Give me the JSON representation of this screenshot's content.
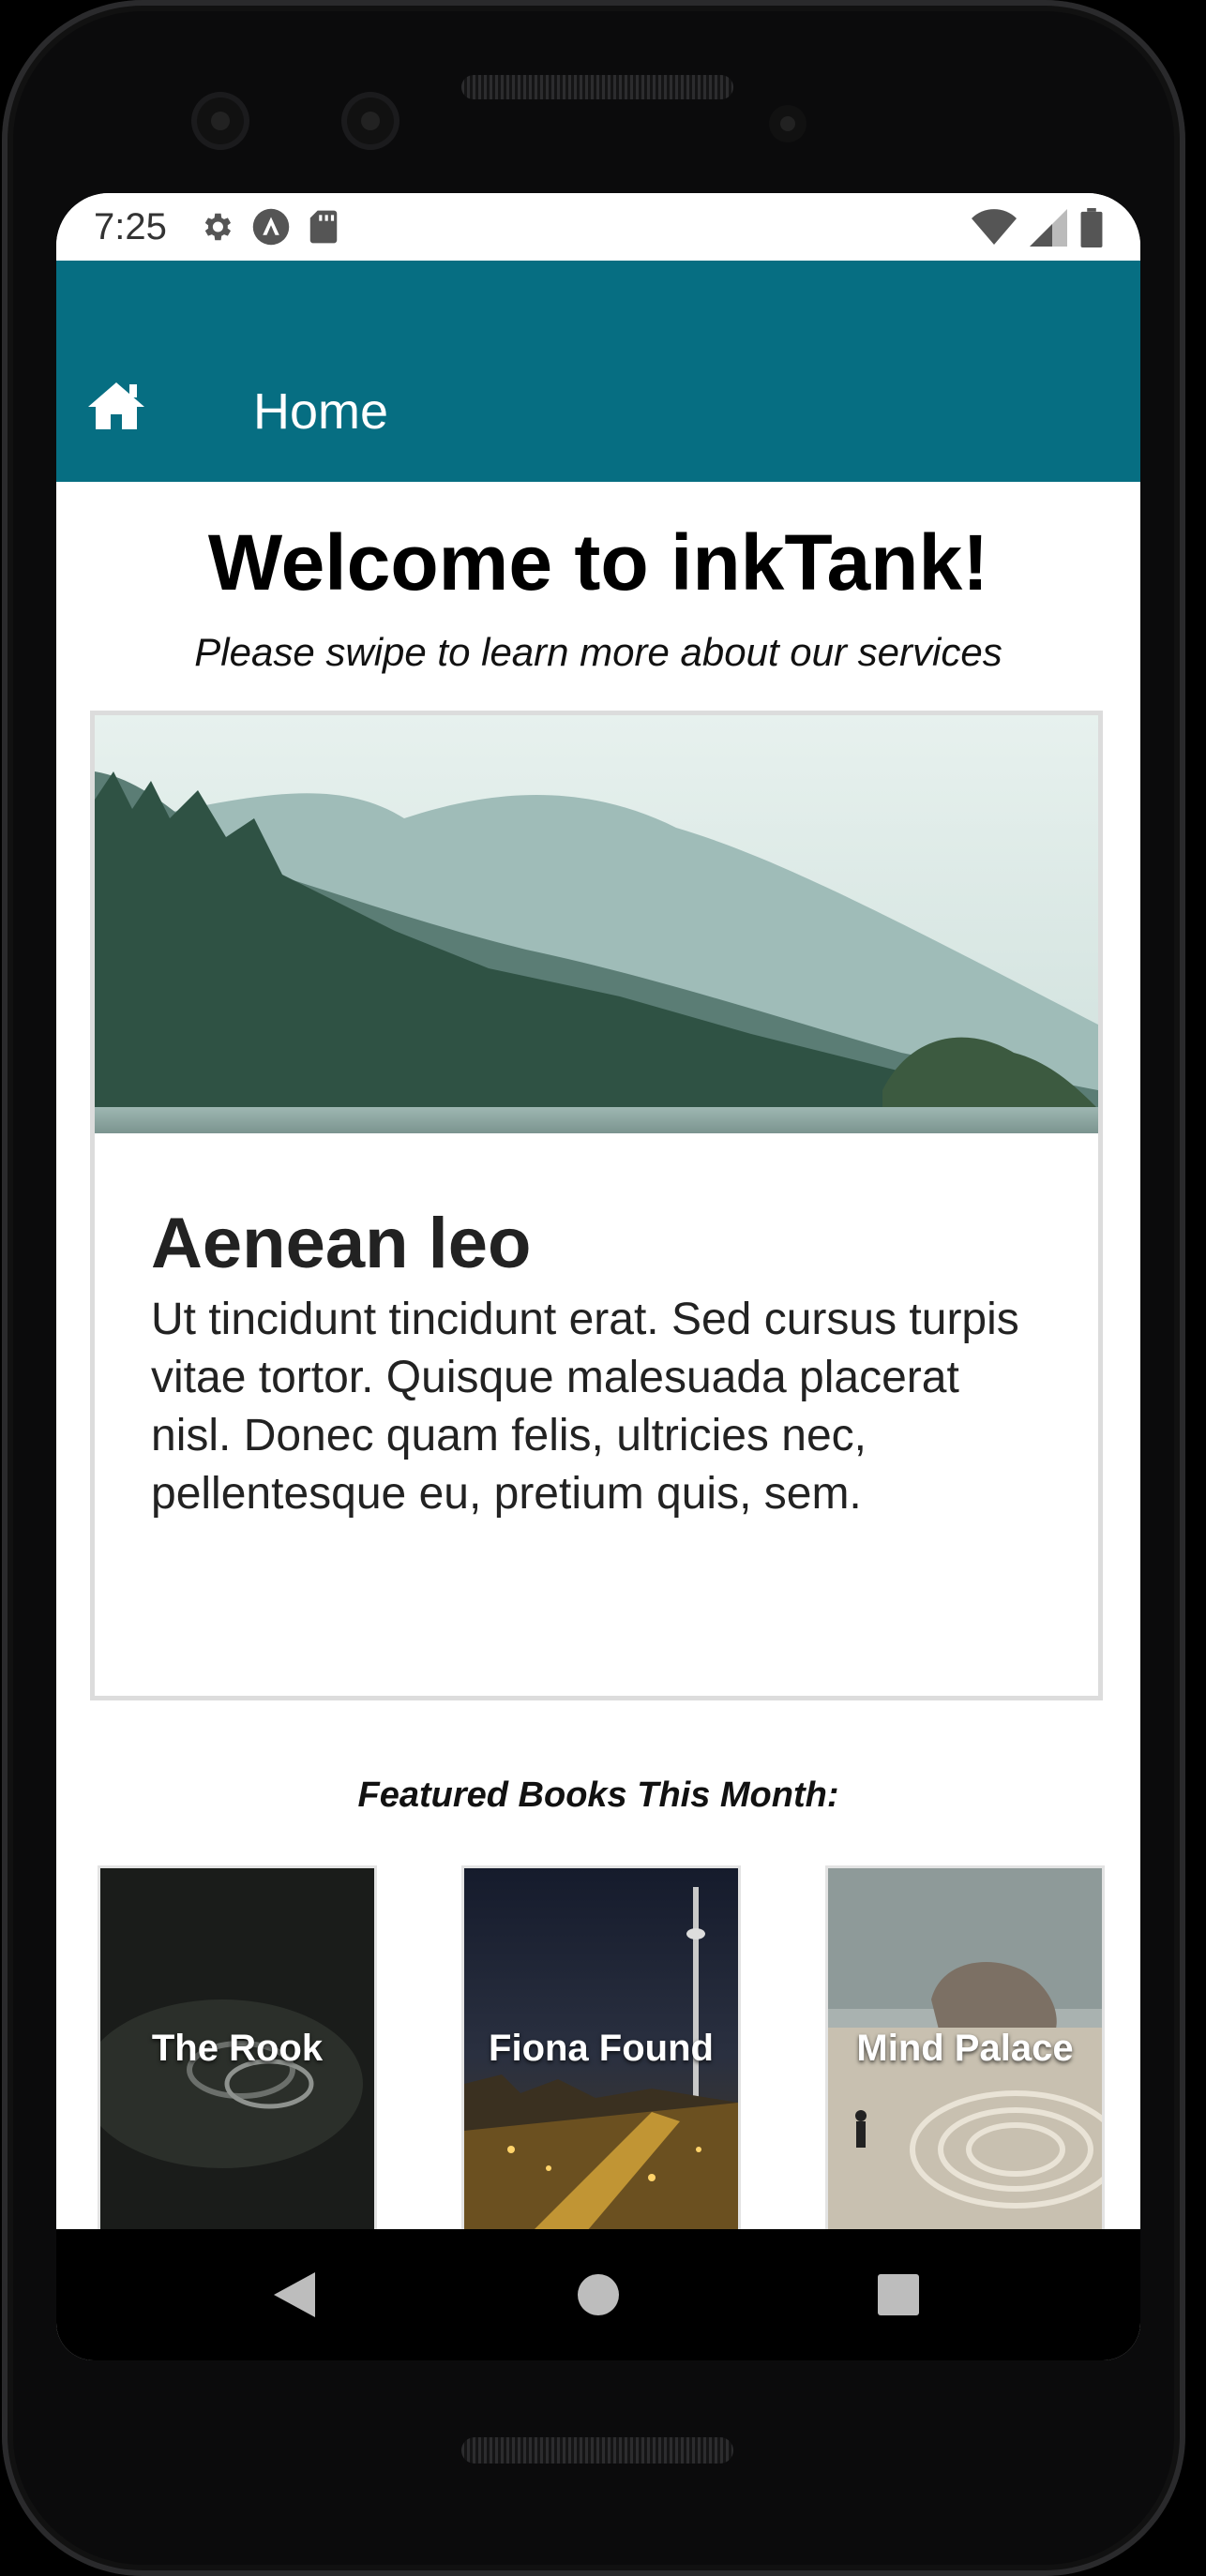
{
  "status_bar": {
    "time": "7:25",
    "left_icons": [
      "gear-icon",
      "a-badge-icon",
      "sd-card-icon"
    ],
    "right_icons": [
      "wifi-icon",
      "signal-icon",
      "battery-icon"
    ]
  },
  "app_bar": {
    "title": "Home",
    "icon": "home-icon",
    "color": "#066e82"
  },
  "main": {
    "welcome": "Welcome to inkTank!",
    "subtitle": "Please swipe to learn more about our services",
    "card": {
      "title": "Aenean leo",
      "body": "Ut tincidunt tincidunt erat. Sed cursus turpis vitae tortor. Quisque malesuada placerat nisl. Donec quam felis, ultricies nec, pellentesque eu, pretium quis, sem."
    },
    "featured_heading": "Featured Books This Month:",
    "books": [
      {
        "title": "The Rook"
      },
      {
        "title": "Fiona Found"
      },
      {
        "title": "Mind Palace"
      }
    ]
  },
  "nav_bar": {
    "icons": [
      "back-icon",
      "home-circle-icon",
      "recents-icon"
    ]
  }
}
